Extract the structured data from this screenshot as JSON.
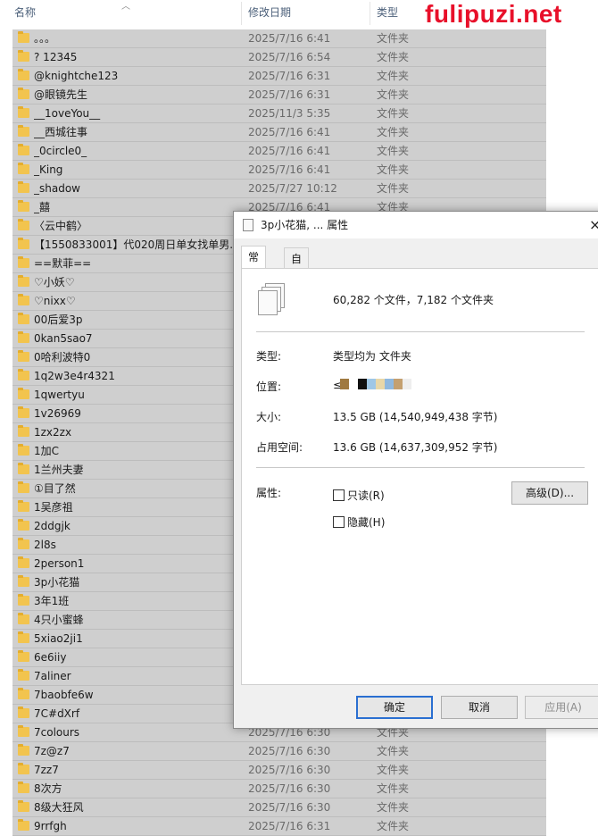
{
  "watermark": "fulipuzi.net",
  "header": {
    "name": "名称",
    "date": "修改日期",
    "type": "类型"
  },
  "rows": [
    {
      "name": "。。。",
      "date": "2025/7/16 6:41",
      "type": "文件夹"
    },
    {
      "name": "? 12345",
      "date": "2025/7/16 6:54",
      "type": "文件夹"
    },
    {
      "name": "@knightche123",
      "date": "2025/7/16 6:31",
      "type": "文件夹"
    },
    {
      "name": "@眼镜先生",
      "date": "2025/7/16 6:31",
      "type": "文件夹"
    },
    {
      "name": "__1oveYou__",
      "date": "2025/11/3 5:35",
      "type": "文件夹"
    },
    {
      "name": "__西城往事",
      "date": "2025/7/16 6:41",
      "type": "文件夹"
    },
    {
      "name": "_0circle0_",
      "date": "2025/7/16 6:41",
      "type": "文件夹"
    },
    {
      "name": "_King",
      "date": "2025/7/16 6:41",
      "type": "文件夹"
    },
    {
      "name": "_shadow",
      "date": "2025/7/27 10:12",
      "type": "文件夹"
    },
    {
      "name": "_囍",
      "date": "2025/7/16 6:41",
      "type": "文件夹"
    },
    {
      "name": "〈云中鹤〉",
      "date": "",
      "type": ""
    },
    {
      "name": "【1550833001】代020周日单女找单男...",
      "date": "",
      "type": ""
    },
    {
      "name": "==默菲==",
      "date": "",
      "type": ""
    },
    {
      "name": "♡小妖♡",
      "date": "",
      "type": ""
    },
    {
      "name": "♡nixx♡",
      "date": "",
      "type": ""
    },
    {
      "name": "00后爱3p",
      "date": "",
      "type": ""
    },
    {
      "name": "0kan5sao7",
      "date": "",
      "type": ""
    },
    {
      "name": "0哈利波特0",
      "date": "",
      "type": ""
    },
    {
      "name": "1q2w3e4r4321",
      "date": "",
      "type": ""
    },
    {
      "name": "1qwertyu",
      "date": "",
      "type": ""
    },
    {
      "name": "1v26969",
      "date": "",
      "type": ""
    },
    {
      "name": "1zx2zx",
      "date": "",
      "type": ""
    },
    {
      "name": "1加C",
      "date": "",
      "type": ""
    },
    {
      "name": "1兰州夫妻",
      "date": "",
      "type": ""
    },
    {
      "name": "①目了然",
      "date": "",
      "type": ""
    },
    {
      "name": "1吴彦祖",
      "date": "",
      "type": ""
    },
    {
      "name": "2ddgjk",
      "date": "",
      "type": ""
    },
    {
      "name": "2l8s",
      "date": "",
      "type": ""
    },
    {
      "name": "2person1",
      "date": "",
      "type": ""
    },
    {
      "name": "3p小花猫",
      "date": "",
      "type": ""
    },
    {
      "name": "3年1班",
      "date": "",
      "type": ""
    },
    {
      "name": "4只小蜜蜂",
      "date": "",
      "type": ""
    },
    {
      "name": "5xiao2ji1",
      "date": "",
      "type": ""
    },
    {
      "name": "6e6iiy",
      "date": "",
      "type": ""
    },
    {
      "name": "7aliner",
      "date": "",
      "type": ""
    },
    {
      "name": "7baobfe6w",
      "date": "",
      "type": ""
    },
    {
      "name": "7C#dXrf",
      "date": "",
      "type": ""
    },
    {
      "name": "7colours",
      "date": "2025/7/16 6:30",
      "type": "文件夹"
    },
    {
      "name": "7z@z7",
      "date": "2025/7/16 6:30",
      "type": "文件夹"
    },
    {
      "name": "7zz7",
      "date": "2025/7/16 6:30",
      "type": "文件夹"
    },
    {
      "name": "8次方",
      "date": "2025/7/16 6:30",
      "type": "文件夹"
    },
    {
      "name": "8级大狂风",
      "date": "2025/7/16 6:30",
      "type": "文件夹"
    },
    {
      "name": "9rrfgh",
      "date": "2025/7/16 6:31",
      "type": "文件夹"
    }
  ],
  "dialog": {
    "title": "3p小花猫, ... 属性",
    "close": "×",
    "tab_general": "常规",
    "tab_custom": "自定义",
    "summary": "60,282 个文件，7,182 个文件夹",
    "type_label": "类型:",
    "type_value": "类型均为 文件夹",
    "location_label": "位置:",
    "location_value": "≤",
    "size_label": "大小:",
    "size_value": "13.5 GB (14,540,949,438 字节)",
    "disk_label": "占用空间:",
    "disk_value": "13.6 GB (14,637,309,952 字节)",
    "attr_label": "属性:",
    "readonly_label": "只读(R)",
    "hidden_label": "隐藏(H)",
    "advanced_label": "高级(D)...",
    "ok_label": "确定",
    "cancel_label": "取消",
    "apply_label": "应用(A)",
    "location_blur_colors": [
      "#a07a40",
      "#ffffff",
      "#111111",
      "#9fc7e6",
      "#e8d7a8",
      "#8fb8df",
      "#c4a070",
      "#eeeeee"
    ]
  }
}
